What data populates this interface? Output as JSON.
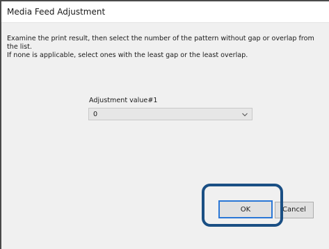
{
  "dialog": {
    "title": "Media Feed Adjustment",
    "instructions": [
      "Examine the print result, then select the number of the pattern without gap or overlap from the list.",
      "If none is applicable, select ones with the least gap or the least overlap."
    ],
    "adjustment": {
      "label": "Adjustment value#1",
      "selected_value": "0"
    },
    "buttons": {
      "ok": "OK",
      "cancel": "Cancel"
    }
  },
  "colors": {
    "highlight": "#1a4f84",
    "focus_border": "#2a77d6",
    "content_bg": "#f0f0f0"
  },
  "icons": {
    "dropdown": "chevron-down-icon"
  }
}
